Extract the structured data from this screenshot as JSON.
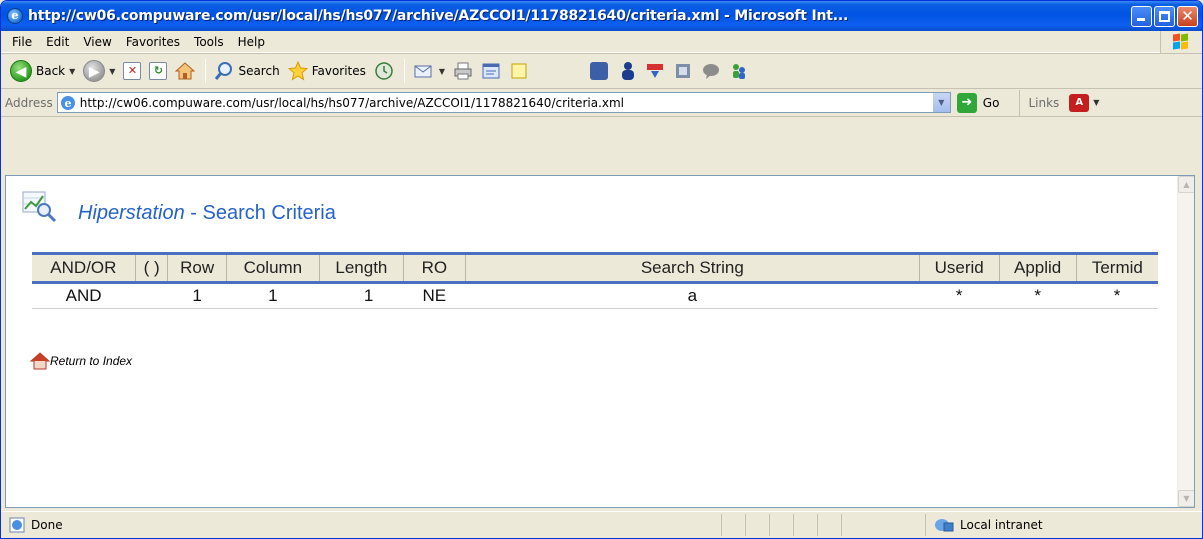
{
  "window": {
    "title": "http://cw06.compuware.com/usr/local/hs/hs077/archive/AZCCOI1/1178821640/criteria.xml - Microsoft Int..."
  },
  "menu": {
    "items": [
      "File",
      "Edit",
      "View",
      "Favorites",
      "Tools",
      "Help"
    ]
  },
  "toolbar": {
    "back_label": "Back",
    "search_label": "Search",
    "favorites_label": "Favorites"
  },
  "address": {
    "label": "Address",
    "url": "http://cw06.compuware.com/usr/local/hs/hs077/archive/AZCCOI1/1178821640/criteria.xml",
    "go_label": "Go",
    "links_label": "Links"
  },
  "page": {
    "title_product": "Hiperstation",
    "title_rest": " - Search Criteria",
    "table": {
      "headers": [
        "AND/OR",
        "( )",
        "Row",
        "Column",
        "Length",
        "RO",
        "Search String",
        "Userid",
        "Applid",
        "Termid"
      ],
      "rows": [
        [
          "AND",
          "",
          "1",
          "1",
          "1",
          "NE",
          "a",
          "*",
          "*",
          "*"
        ]
      ]
    },
    "return_link": "Return to Index"
  },
  "status": {
    "text": "Done",
    "zone": "Local intranet"
  },
  "colors": {
    "title_blue": "#2663c7",
    "table_rule": "#4a6fc0",
    "titlebar": "#0054e3"
  }
}
